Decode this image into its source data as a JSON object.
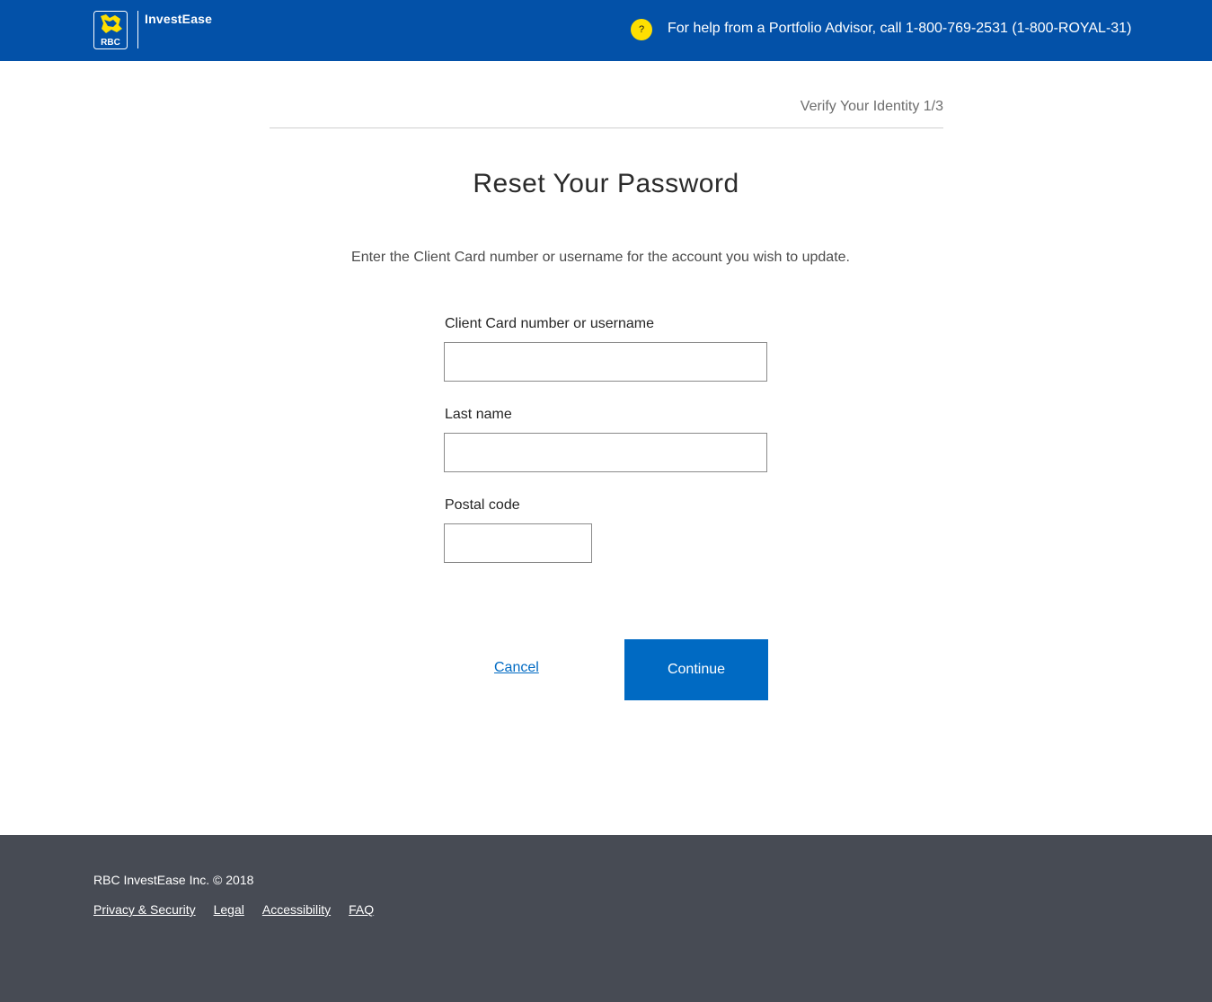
{
  "header": {
    "logo_text": "RBC",
    "brand": "InvestEase",
    "help_icon_glyph": "?",
    "help_text": "For help from a Portfolio Advisor, call 1-800-769-2531 (1-800-ROYAL-31)"
  },
  "progress": {
    "step_label": "Verify Your Identity 1/3"
  },
  "form": {
    "title": "Reset Your Password",
    "intro": "Enter the Client Card number or username for the account you wish to update.",
    "client_card_label": "Client Card number or username",
    "client_card_value": "",
    "last_name_label": "Last name",
    "last_name_value": "",
    "postal_code_label": "Postal code",
    "postal_code_value": "",
    "cancel_label": "Cancel",
    "continue_label": "Continue"
  },
  "footer": {
    "copyright": "RBC InvestEase Inc. © 2018",
    "links": [
      "Privacy & Security",
      "Legal",
      "Accessibility",
      "FAQ"
    ]
  },
  "colors": {
    "header_bg": "#0351a8",
    "primary_button": "#006ac3",
    "help_icon": "#fedf01",
    "footer_bg": "#474b54"
  }
}
